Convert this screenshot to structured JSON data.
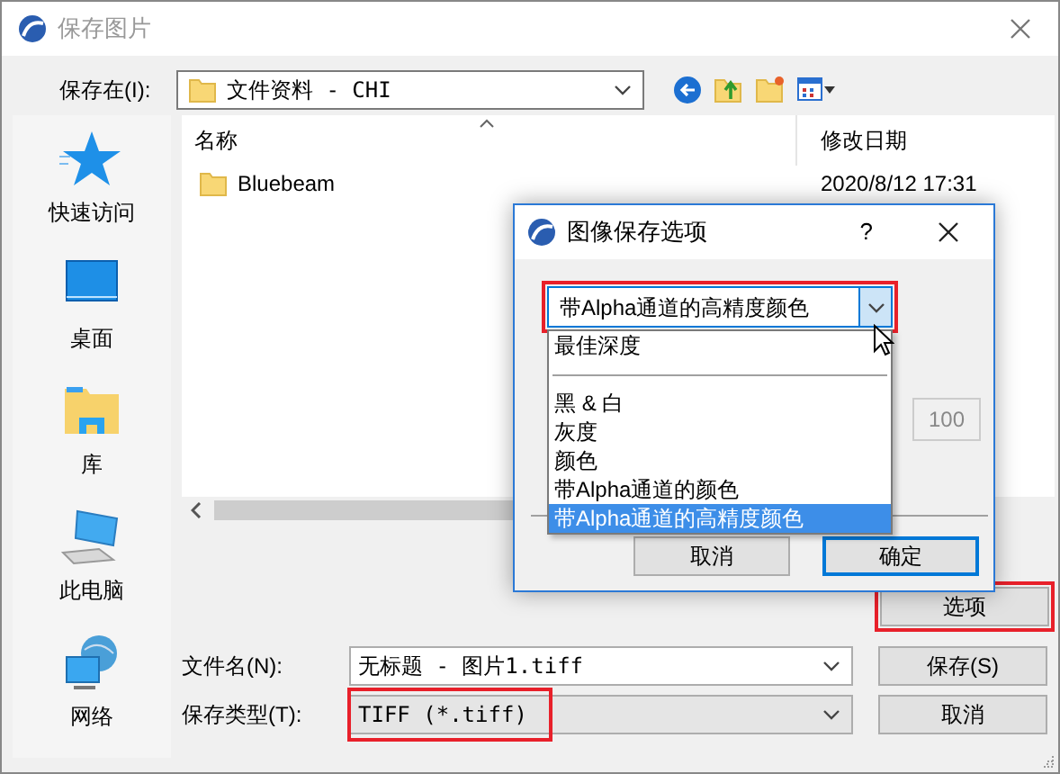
{
  "window": {
    "title": "保存图片"
  },
  "location": {
    "label": "保存在(I):",
    "value": "文件资料 - CHI"
  },
  "places": [
    {
      "label": "快速访问",
      "kind": "star"
    },
    {
      "label": "桌面",
      "kind": "desktop"
    },
    {
      "label": "库",
      "kind": "library"
    },
    {
      "label": "此电脑",
      "kind": "computer"
    },
    {
      "label": "网络",
      "kind": "network"
    }
  ],
  "file_list": {
    "columns": [
      "名称",
      "修改日期"
    ],
    "rows": [
      {
        "name": "Bluebeam",
        "date": "2020/8/12 17:31"
      }
    ]
  },
  "options_button": {
    "label": "选项",
    "highlighted": true
  },
  "file_name": {
    "label": "文件名(N):",
    "value": "无标题 - 图片1.tiff"
  },
  "file_type": {
    "label": "保存类型(T):",
    "value": "TIFF (*.tiff)",
    "highlighted": true
  },
  "buttons": [
    "保存(S)",
    "取消"
  ],
  "options_dialog": {
    "title": "图像保存选项",
    "help": "?",
    "color_mode": {
      "value": "带Alpha通道的高精度颜色",
      "highlighted": true,
      "options": [
        {
          "kind": "item",
          "label": "最佳深度",
          "selected": false
        },
        {
          "kind": "separator"
        },
        {
          "kind": "item",
          "label": "黑 & 白",
          "selected": false
        },
        {
          "kind": "item",
          "label": "灰度",
          "selected": false
        },
        {
          "kind": "item",
          "label": "颜色",
          "selected": false
        },
        {
          "kind": "item",
          "label": "带Alpha通道的颜色",
          "selected": false
        },
        {
          "kind": "item",
          "label": "带Alpha通道的高精度颜色",
          "selected": true
        }
      ]
    },
    "quality": {
      "value": "100",
      "disabled": true
    },
    "buttons": [
      {
        "label": "取消",
        "default": false
      },
      {
        "label": "确定",
        "default": true
      }
    ]
  }
}
